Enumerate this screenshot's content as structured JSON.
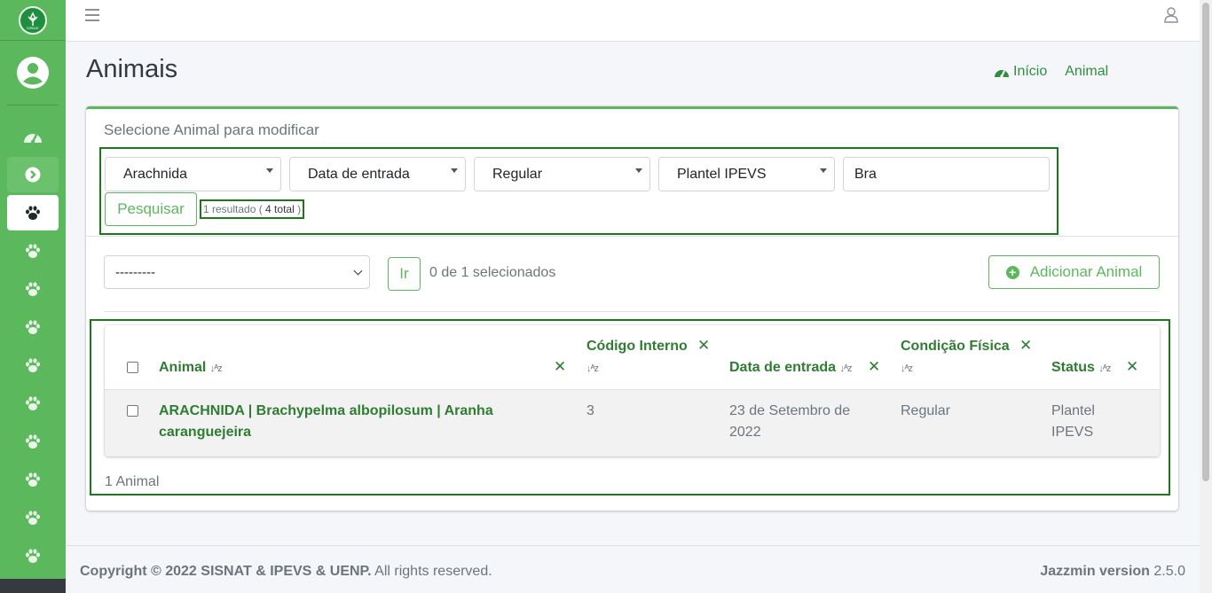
{
  "sidebar": {
    "logo_text": "SISNAT",
    "icons": [
      "logo-icon",
      "user-avatar-icon",
      "dashboard-icon",
      "arrow-circle-icon",
      "paw-icon"
    ]
  },
  "header": {
    "title": "Animais",
    "breadcrumb": {
      "home": "Início",
      "current": "Animal"
    }
  },
  "card": {
    "title": "Selecione Animal para modificar",
    "filters": {
      "class": "Arachnida",
      "date": "Data de entrada",
      "condition": "Regular",
      "status": "Plantel IPEVS",
      "search_value": "Bra"
    },
    "search_button": "Pesquisar",
    "result_text_prefix": "1 resultado (",
    "result_total": "4 total",
    "result_text_suffix": ")"
  },
  "actions": {
    "select_value": "---------",
    "go_button": "Ir",
    "selected_count": "0 de 1 selecionados",
    "add_button": "Adicionar Animal"
  },
  "table": {
    "headers": {
      "animal": "Animal",
      "codigo_line1": "Código Interno",
      "data": "Data de entrada",
      "condicao_line1": "Condição Física",
      "status": "Status"
    },
    "rows": [
      {
        "animal_line1": "ARACHNIDA | Brachypelma albopilosum | Aranha",
        "animal_line2": "caranguejeira",
        "codigo": "3",
        "data_line1": "23 de Setembro de",
        "data_line2": "2022",
        "condicao": "Regular",
        "status_line1": "Plantel",
        "status_line2": "IPEVS"
      }
    ],
    "count": "1 Animal"
  },
  "footer": {
    "copyright": "Copyright © 2022 SISNAT & IPEVS & UENP.",
    "rights": " All rights reserved.",
    "version_label": "Jazzmin version",
    "version": "2.5.0"
  },
  "colors": {
    "accent": "#5cb85c",
    "dark_green": "#2e7d32",
    "highlight_box": "#1a7a1a"
  }
}
